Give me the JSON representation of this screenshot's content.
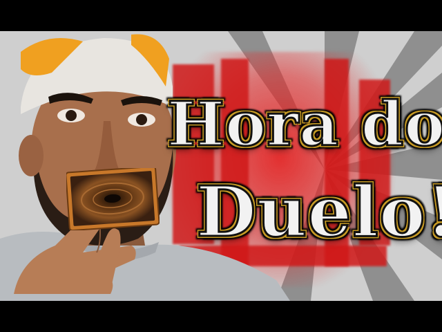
{
  "thumbnail": {
    "title_line1": "Hora do",
    "title_line2": "Duelo!",
    "colors": {
      "title_fill": "#f2f2f2",
      "title_outline": "#111111",
      "title_gold": "#c79a24",
      "kanji_red": "#d01818",
      "background_gray": "#d9d9d9",
      "shirt_gray": "#b8bcc0",
      "card_orange": "#c8782a"
    },
    "icons": [
      "playing-card-icon"
    ]
  }
}
